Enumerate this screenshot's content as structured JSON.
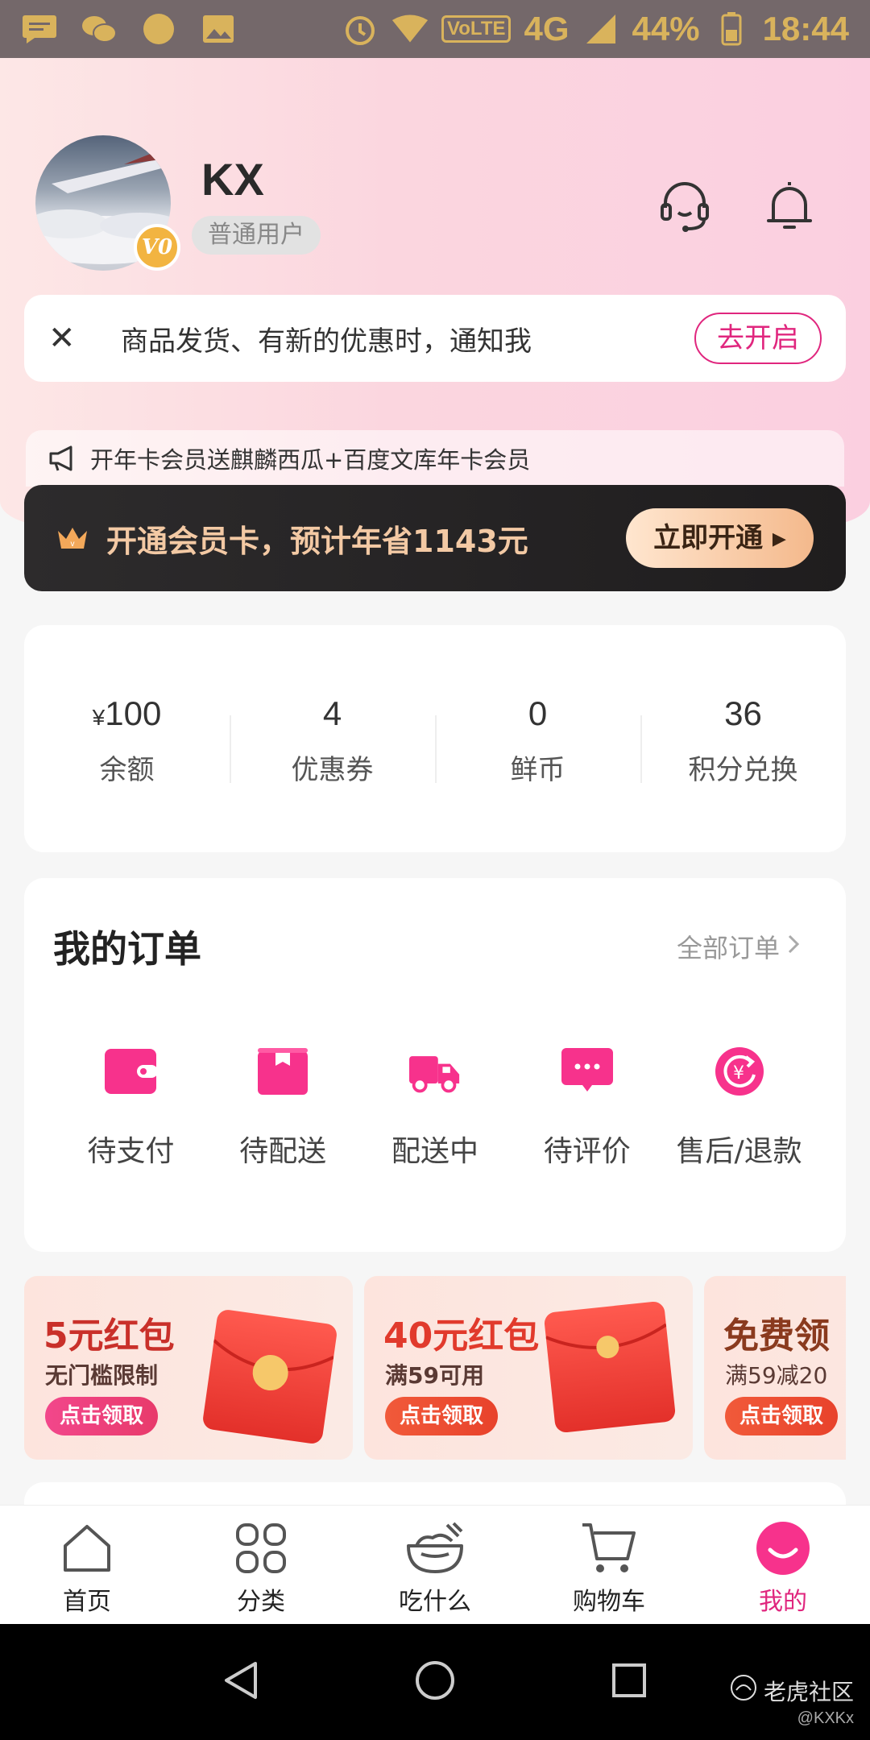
{
  "status_bar": {
    "network": "4G",
    "volte": "VoLTE",
    "battery": "44%",
    "time": "18:44"
  },
  "profile": {
    "username": "KX",
    "level_badge": "V0",
    "user_type": "普通用户"
  },
  "header_icons": [
    "headset-icon",
    "bell-icon"
  ],
  "notify": {
    "text": "商品发货、有新的优惠时，通知我",
    "button": "去开启"
  },
  "promo": {
    "text": "开年卡会员送麒麟西瓜+百度文库年卡会员"
  },
  "vip": {
    "text": "开通会员卡，预计年省1143元",
    "button": "立即开通"
  },
  "assets": [
    {
      "currency": "¥",
      "value": "100",
      "label": "余额"
    },
    {
      "currency": "",
      "value": "4",
      "label": "优惠券"
    },
    {
      "currency": "",
      "value": "0",
      "label": "鲜币"
    },
    {
      "currency": "",
      "value": "36",
      "label": "积分兑换"
    }
  ],
  "orders": {
    "title": "我的订单",
    "all_link": "全部订单",
    "items": [
      {
        "label": "待支付",
        "icon": "wallet-icon"
      },
      {
        "label": "待配送",
        "icon": "package-icon"
      },
      {
        "label": "配送中",
        "icon": "delivery-truck-icon"
      },
      {
        "label": "待评价",
        "icon": "comment-icon"
      },
      {
        "label": "售后/退款",
        "icon": "refund-icon"
      }
    ]
  },
  "coupons": [
    {
      "title": "5元红包",
      "subtitle": "无门槛限制",
      "button": "点击领取"
    },
    {
      "title": "40元红包",
      "subtitle": "满59可用",
      "button": "点击领取"
    },
    {
      "title": "免费领",
      "subtitle": "满59减20",
      "button": "点击领取"
    }
  ],
  "tabbar": [
    {
      "label": "首页",
      "icon": "home-icon"
    },
    {
      "label": "分类",
      "icon": "grid-icon"
    },
    {
      "label": "吃什么",
      "icon": "bowl-icon"
    },
    {
      "label": "购物车",
      "icon": "cart-icon"
    },
    {
      "label": "我的",
      "icon": "profile-smile-icon"
    }
  ],
  "watermark": {
    "text": "老虎社区",
    "user": "@KXKx"
  },
  "colors": {
    "accent": "#e0267e",
    "vip_gold": "#f3c9a4",
    "status_icon": "#d9b35c"
  }
}
